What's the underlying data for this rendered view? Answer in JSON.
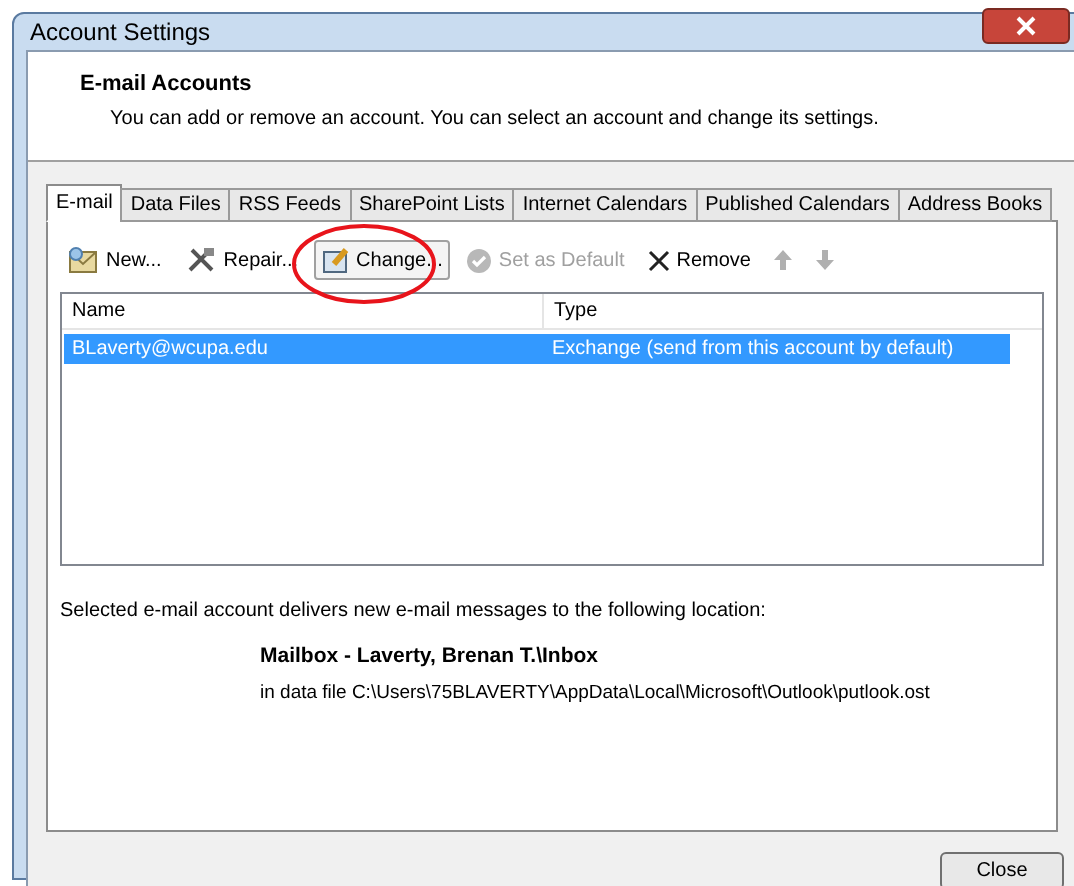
{
  "window": {
    "title": "Account Settings"
  },
  "header": {
    "title": "E-mail Accounts",
    "description": "You can add or remove an account. You can select an account and change its settings."
  },
  "tabs": [
    {
      "label": "E-mail",
      "selected": true
    },
    {
      "label": "Data Files",
      "selected": false
    },
    {
      "label": "RSS Feeds",
      "selected": false
    },
    {
      "label": "SharePoint Lists",
      "selected": false
    },
    {
      "label": "Internet Calendars",
      "selected": false
    },
    {
      "label": "Published Calendars",
      "selected": false
    },
    {
      "label": "Address Books",
      "selected": false
    }
  ],
  "toolbar": [
    {
      "kind": "new",
      "label": "New...",
      "disabled": false,
      "focused": false
    },
    {
      "kind": "repair",
      "label": "Repair...",
      "disabled": false,
      "focused": false
    },
    {
      "kind": "change",
      "label": "Change...",
      "disabled": false,
      "focused": true
    },
    {
      "kind": "default",
      "label": "Set as Default",
      "disabled": true,
      "focused": false
    },
    {
      "kind": "remove",
      "label": "Remove",
      "disabled": false,
      "focused": false
    },
    {
      "kind": "up",
      "disabled": true,
      "focused": false
    },
    {
      "kind": "down",
      "disabled": true,
      "focused": false
    }
  ],
  "table": {
    "columns": [
      "Name",
      "Type"
    ],
    "rows": [
      {
        "cells": [
          "BLaverty@wcupa.edu",
          "Exchange (send from this account by default)"
        ],
        "selected": true
      }
    ]
  },
  "delivery": {
    "text": "Selected e-mail account delivers new e-mail messages to the following location:",
    "mailbox": "Mailbox - Laverty, Brenan T.\\Inbox",
    "data_file": "in data file C:\\Users\\75BLAVERTY\\AppData\\Local\\Microsoft\\Outlook\\putlook.ost"
  },
  "buttons": [
    {
      "label": "Close"
    }
  ]
}
